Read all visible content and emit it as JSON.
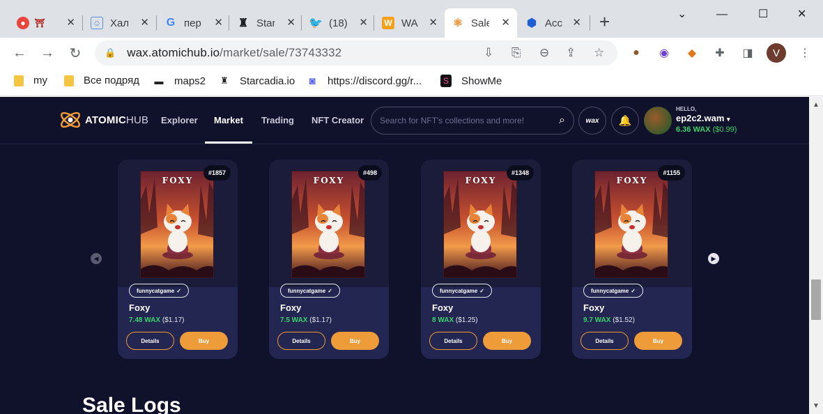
{
  "browser": {
    "tabs": [
      {
        "title": "",
        "favicon_color": "#e8453c",
        "icon": "chrome-icon"
      },
      {
        "title": "Хал",
        "favicon_color": "#5b8fd6",
        "icon": "face-icon"
      },
      {
        "title": "пер",
        "favicon_color": "#4285f4",
        "icon": "google-icon"
      },
      {
        "title": "Star",
        "favicon_color": "#202124",
        "icon": "starcadia-icon"
      },
      {
        "title": "(18)",
        "favicon_color": "#1d9bf0",
        "icon": "twitter-icon"
      },
      {
        "title": "WA",
        "favicon_color": "#f4a21b",
        "icon": "wax-icon"
      },
      {
        "title": "Sale",
        "favicon_color": "#f08a24",
        "icon": "atomichub-icon"
      },
      {
        "title": "Acc",
        "favicon_color": "#1e5fd6",
        "icon": "cube-icon"
      }
    ],
    "url_host": "wax.atomichub.io",
    "url_path": "/market/sale/73743332",
    "profile_initial": "V",
    "bookmarks": [
      {
        "label": "my",
        "icon": "folder-icon"
      },
      {
        "label": "Все подряд",
        "icon": "folder-icon"
      },
      {
        "label": "maps2",
        "icon": "maps2-icon"
      },
      {
        "label": "Starcadia.io",
        "icon": "starcadia-icon"
      },
      {
        "label": "https://discord.gg/r...",
        "icon": "discord-icon"
      },
      {
        "label": "ShowMe",
        "icon": "showme-icon"
      }
    ]
  },
  "site": {
    "logo_atomic": "ATOMIC",
    "logo_hub": "HUB",
    "nav": [
      "Explorer",
      "Market",
      "Trading",
      "NFT Creator"
    ],
    "active_nav": "Market",
    "search_placeholder": "Search for NFT's collections and more!",
    "wax_label": "wax",
    "hello": "HELLO,",
    "username": "ep2c2.wam",
    "balance_wax": "6.36 WAX",
    "balance_usd": "($0.99)",
    "accent": "#ee9b3a",
    "green": "#39d36c"
  },
  "cards": [
    {
      "badge": "#1857",
      "collection": "funnycatgame",
      "name": "Foxy",
      "price_wax": "7.48 WAX",
      "price_usd": "($1.17)",
      "details": "Details",
      "buy": "Buy",
      "art_title": "FOXY"
    },
    {
      "badge": "#498",
      "collection": "funnycatgame",
      "name": "Foxy",
      "price_wax": "7.5 WAX",
      "price_usd": "($1.17)",
      "details": "Details",
      "buy": "Buy",
      "art_title": "FOXY"
    },
    {
      "badge": "#1348",
      "collection": "funnycatgame",
      "name": "Foxy",
      "price_wax": "8 WAX",
      "price_usd": "($1.25)",
      "details": "Details",
      "buy": "Buy",
      "art_title": "FOXY"
    },
    {
      "badge": "#1155",
      "collection": "funnycatgame",
      "name": "Foxy",
      "price_wax": "9.7 WAX",
      "price_usd": "($1.52)",
      "details": "Details",
      "buy": "Buy",
      "art_title": "FOXY"
    }
  ],
  "section_title": "Sale Logs"
}
